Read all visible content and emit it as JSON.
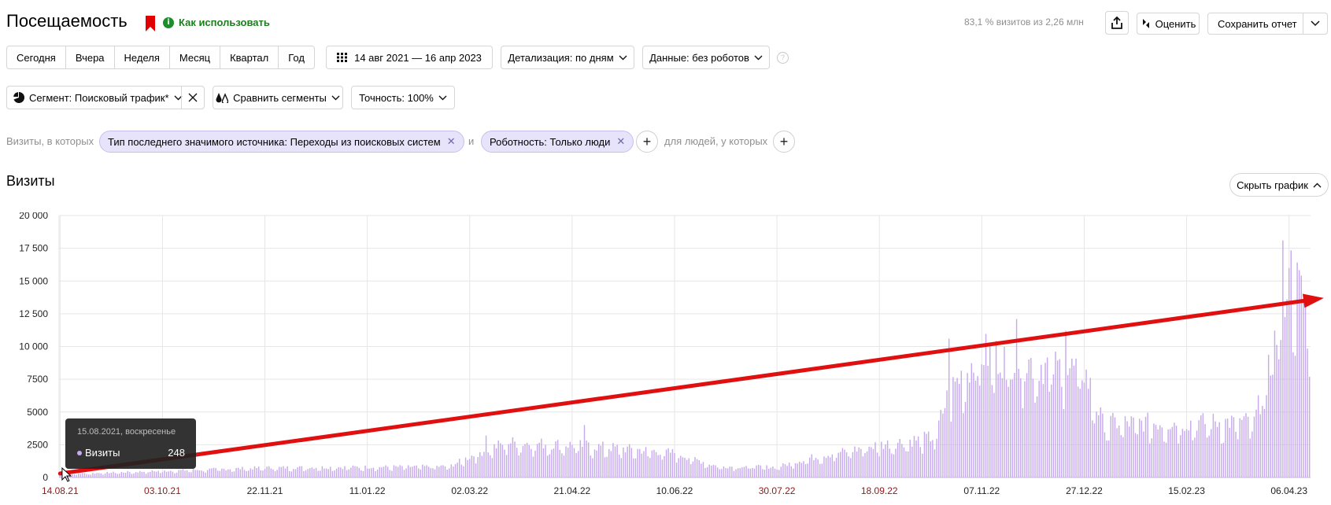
{
  "header": {
    "title": "Посещаемость",
    "how_to_use": "Как использовать",
    "sample": "83,1 % визитов из 2,26 млн",
    "rate_label": "Оценить",
    "save_label": "Сохранить отчет"
  },
  "period": {
    "buttons": [
      "Сегодня",
      "Вчера",
      "Неделя",
      "Месяц",
      "Квартал",
      "Год"
    ],
    "date_range": "14 авг 2021 — 16 апр 2023",
    "detail": "Детализация: по дням",
    "data_filter": "Данные: без роботов"
  },
  "segment": {
    "segment_label": "Сегмент: Поисковый трафик*",
    "compare_label": "Сравнить сегменты",
    "accuracy_label": "Точность: 100%"
  },
  "filters": {
    "prefix": "Визиты, в которых",
    "chip1": "Тип последнего значимого источника: Переходы из поисковых систем",
    "joiner": "и",
    "chip2": "Роботность: Только люди",
    "people_label": "для людей, у которых"
  },
  "chart_section": {
    "title": "Визиты",
    "hide_label": "Скрыть график"
  },
  "colors": {
    "bar": "#c6a9ee",
    "arrow": "#e01010",
    "accent_red_tick": "#8b1a1a",
    "chip_bg": "#e6e3fb"
  },
  "tooltip": {
    "date": "15.08.2021, воскресенье",
    "series": "Визиты",
    "value": "248"
  },
  "chart_data": {
    "type": "bar",
    "title": "Визиты",
    "ylim": [
      0,
      20000
    ],
    "yticks": [
      "0",
      "2500",
      "5000",
      "7500",
      "10 000",
      "12 500",
      "15 000",
      "17 500",
      "20 000"
    ],
    "xticks": [
      {
        "label": "14.08.21",
        "weekend": true
      },
      {
        "label": "03.10.21",
        "weekend": true
      },
      {
        "label": "22.11.21",
        "weekend": false
      },
      {
        "label": "11.01.22",
        "weekend": false
      },
      {
        "label": "02.03.22",
        "weekend": false
      },
      {
        "label": "21.04.22",
        "weekend": false
      },
      {
        "label": "10.06.22",
        "weekend": false
      },
      {
        "label": "30.07.22",
        "weekend": true
      },
      {
        "label": "18.09.22",
        "weekend": true
      },
      {
        "label": "07.11.22",
        "weekend": false
      },
      {
        "label": "27.12.22",
        "weekend": false
      },
      {
        "label": "15.02.23",
        "weekend": false
      },
      {
        "label": "06.04.23",
        "weekend": false
      }
    ],
    "grid": true,
    "x_start": "2021-08-14",
    "x_end": "2023-04-16",
    "series": [
      {
        "name": "Визиты",
        "trend_keypoints": [
          [
            "2021-08-14",
            250
          ],
          [
            "2021-10-03",
            500
          ],
          [
            "2021-11-22",
            750
          ],
          [
            "2022-01-11",
            800
          ],
          [
            "2022-02-20",
            850
          ],
          [
            "2022-03-05",
            1800
          ],
          [
            "2022-03-20",
            2700
          ],
          [
            "2022-04-21",
            2500
          ],
          [
            "2022-05-10",
            2300
          ],
          [
            "2022-06-10",
            1900
          ],
          [
            "2022-07-01",
            850
          ],
          [
            "2022-07-30",
            800
          ],
          [
            "2022-08-15",
            1500
          ],
          [
            "2022-09-18",
            2500
          ],
          [
            "2022-10-15",
            3100
          ],
          [
            "2022-10-22",
            6500
          ],
          [
            "2022-10-29",
            8000
          ],
          [
            "2022-11-07",
            9500
          ],
          [
            "2022-12-10",
            8500
          ],
          [
            "2022-12-27",
            8200
          ],
          [
            "2023-01-05",
            4200
          ],
          [
            "2023-02-15",
            4200
          ],
          [
            "2023-03-20",
            4300
          ],
          [
            "2023-03-28",
            8500
          ],
          [
            "2023-04-06",
            16000
          ],
          [
            "2023-04-16",
            12500
          ]
        ],
        "spikes": [
          [
            "2022-10-22",
            10600
          ],
          [
            "2022-11-24",
            12100
          ],
          [
            "2022-12-18",
            11200
          ],
          [
            "2022-03-10",
            3200
          ],
          [
            "2022-04-27",
            4000
          ],
          [
            "2023-04-03",
            18100
          ],
          [
            "2023-04-06",
            16000
          ]
        ]
      }
    ],
    "trend_arrow": {
      "from": [
        "2021-08-14",
        300
      ],
      "to": [
        "2023-04-23",
        13700
      ]
    }
  }
}
